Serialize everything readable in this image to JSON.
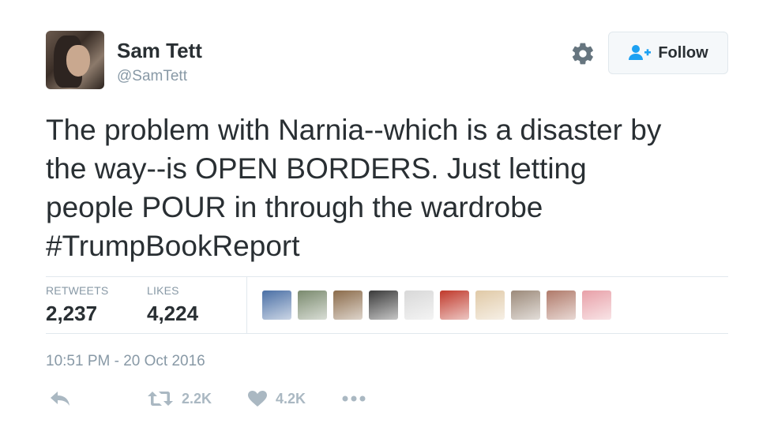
{
  "header": {
    "display_name": "Sam Tett",
    "screen_name": "@SamTett",
    "follow_label": "Follow"
  },
  "tweet": {
    "text": "The problem with Narnia--which is a disaster by\nthe way--is OPEN BORDERS. Just letting\npeople POUR in through the wardrobe\n#TrumpBookReport"
  },
  "stats": {
    "retweets_label": "RETWEETS",
    "retweets_value": "2,237",
    "likes_label": "LIKES",
    "likes_value": "4,224"
  },
  "likers": [
    {
      "name": "liker-avatar-1",
      "color": "#4a6fa5"
    },
    {
      "name": "liker-avatar-2",
      "color": "#7a8a6e"
    },
    {
      "name": "liker-avatar-3",
      "color": "#8b6b4a"
    },
    {
      "name": "liker-avatar-4",
      "color": "#3a3a3a"
    },
    {
      "name": "liker-avatar-5",
      "color": "#d8d8d8"
    },
    {
      "name": "liker-avatar-6",
      "color": "#c0392b"
    },
    {
      "name": "liker-avatar-7",
      "color": "#e0c9a6"
    },
    {
      "name": "liker-avatar-8",
      "color": "#9c8a7a"
    },
    {
      "name": "liker-avatar-9",
      "color": "#b07a6a"
    },
    {
      "name": "liker-avatar-10",
      "color": "#e8a0a8"
    }
  ],
  "timestamp": "10:51 PM - 20 Oct 2016",
  "actions": {
    "retweet_count": "2.2K",
    "like_count": "4.2K"
  },
  "colors": {
    "text": "#292f33",
    "muted": "#8899a6",
    "action_icon": "#aab8c2",
    "follow_icon": "#1da1f2",
    "divider": "#e1e8ed"
  },
  "icons": [
    "gear-icon",
    "follow-person-plus-icon",
    "reply-icon",
    "retweet-icon",
    "heart-icon",
    "more-dots-icon"
  ]
}
